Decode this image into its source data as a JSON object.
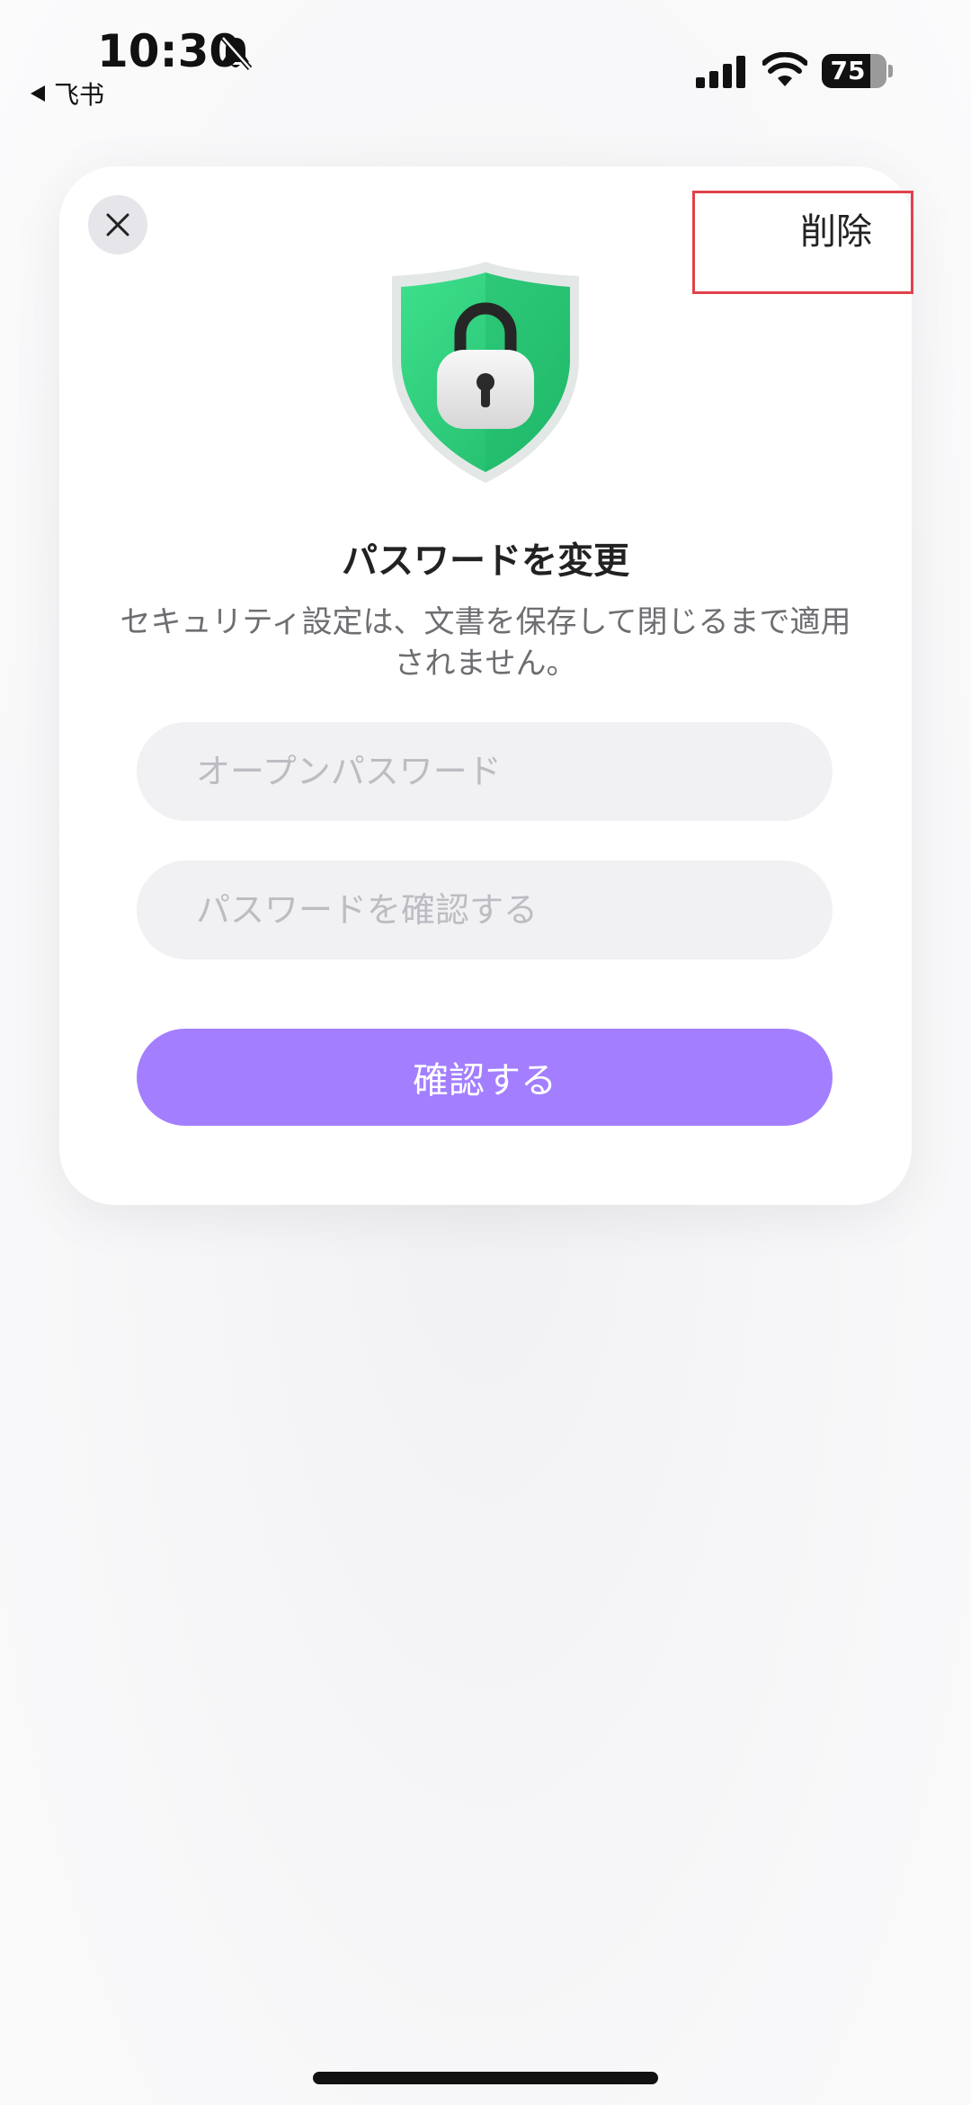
{
  "status_bar": {
    "time": "10:30",
    "back_app": "飞书",
    "battery_level": "75",
    "battery_fraction": 0.75,
    "icons": [
      "bell-muted-icon",
      "back-arrow-icon",
      "signal-icon",
      "wifi-icon",
      "battery-icon"
    ]
  },
  "dialog": {
    "close_icon": "close-icon",
    "delete_label": "削除",
    "illustration": "shield-lock-icon",
    "title": "パスワードを変更",
    "subtitle": "セキュリティ設定は、文書を保存して閉じるまで適用されません。",
    "open_password_placeholder": "オープンパスワード",
    "confirm_password_placeholder": "パスワードを確認する",
    "open_password_value": "",
    "confirm_password_value": "",
    "confirm_label": "確認する"
  },
  "colors": {
    "accent": "#a37fff",
    "shield": "#2fd17f",
    "highlight": "#e0424a"
  }
}
